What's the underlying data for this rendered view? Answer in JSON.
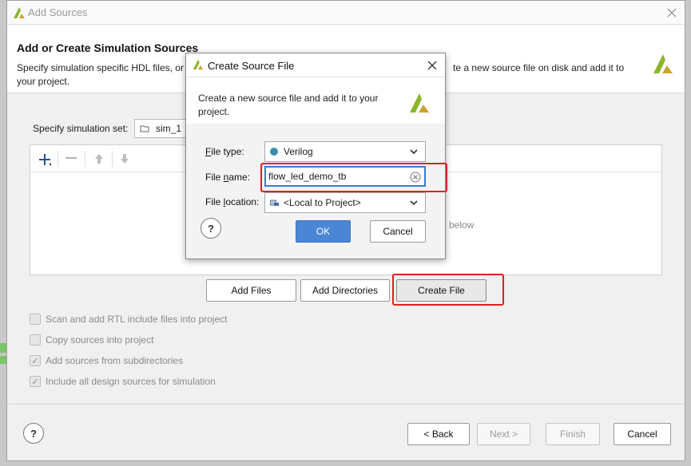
{
  "main": {
    "title": "Add Sources",
    "heading": "Add or Create Simulation Sources",
    "description_line1": "Specify simulation specific HDL files, or",
    "description_line1_tail": "te a new source file on disk and add it to",
    "description_line2": "your project.",
    "sim_set_label": "Specify simulation set:",
    "sim_set_value": "sim_1",
    "panel_hint": "below",
    "buttons": {
      "add_files": "Add Files",
      "add_directories": "Add Directories",
      "create_file": "Create File",
      "back": "< Back",
      "next": "Next >",
      "finish": "Finish",
      "cancel": "Cancel"
    },
    "options": [
      {
        "label": "Scan and add RTL include files into project",
        "checked": false
      },
      {
        "label": "Copy sources into project",
        "checked": false
      },
      {
        "label": "Add sources from subdirectories",
        "checked": true
      },
      {
        "label": "Include all design sources for simulation",
        "checked": true
      }
    ],
    "help": "?"
  },
  "dialog": {
    "title": "Create Source File",
    "description_line1": "Create a new source file and add it to your",
    "description_line2": "project.",
    "file_type_label": "File type:",
    "file_type_value": "Verilog",
    "file_name_label": "File name:",
    "file_name_value": "flow_led_demo_tb",
    "file_location_label": "File location:",
    "file_location_value": "<Local to Project>",
    "ok": "OK",
    "cancel": "Cancel",
    "help": "?"
  },
  "colors": {
    "highlight": "#e0201e",
    "primary_button": "#4a86d4",
    "verilog_dot": "#3d8fa8",
    "logo_green": "#8bb52a"
  }
}
